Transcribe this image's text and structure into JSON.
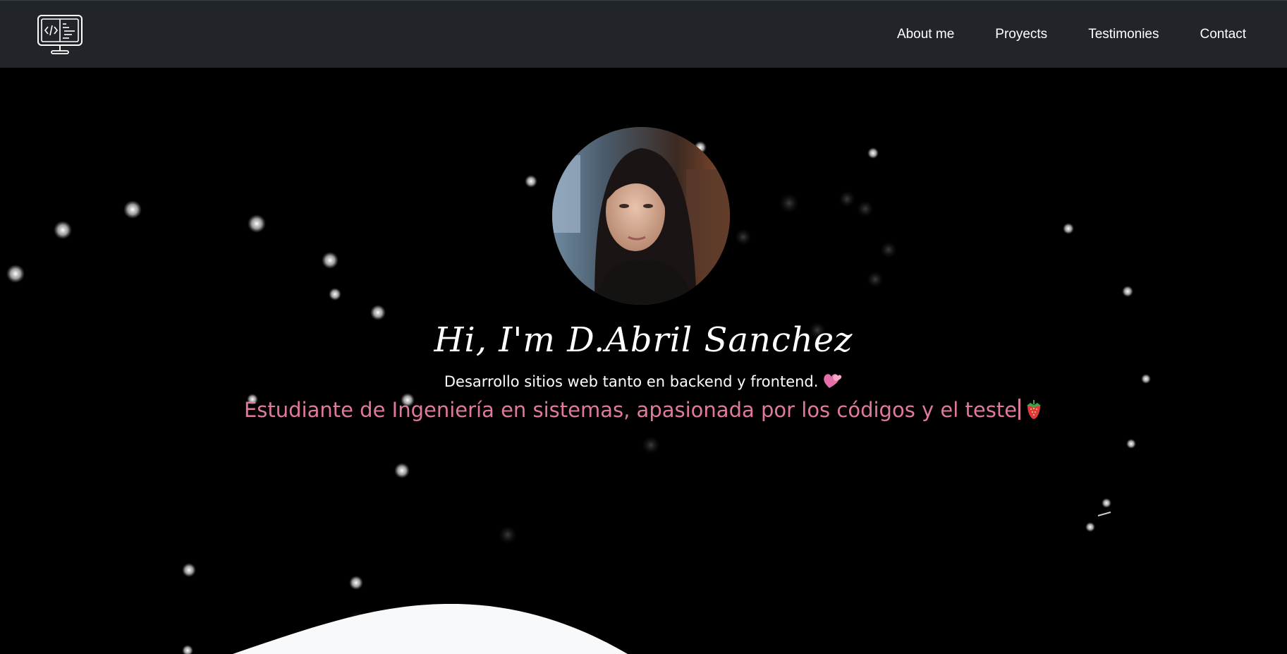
{
  "navbar": {
    "logo_icon": "monitor-code-icon",
    "links": [
      "About me",
      "Proyects",
      "Testimonies",
      "Contact"
    ]
  },
  "hero": {
    "avatar_icon": "profile-photo",
    "headline": "Hi, I'm D.Abril Sanchez",
    "subline": "Desarrollo sitios web tanto en backend y frontend.",
    "subline_emoji": "hearts-emoji",
    "tagline": "Estudiante de Ingeniería en sistemas, apasionada por los códigos y el teste",
    "tagline_emoji": "strawberry-emoji"
  },
  "colors": {
    "navbar_bg": "#212529",
    "hero_bg": "#000000",
    "accent_pink": "#e07a9a",
    "wave": "#f8f9fa"
  }
}
